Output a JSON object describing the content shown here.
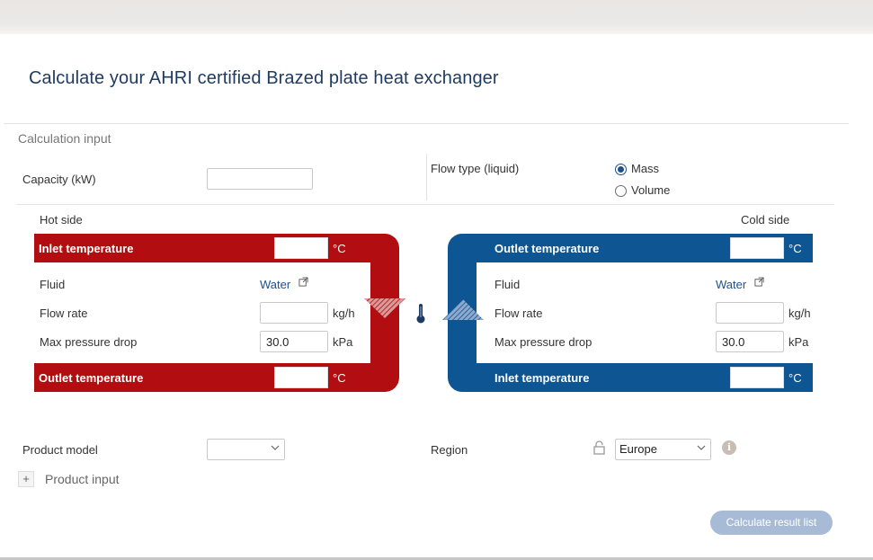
{
  "page": {
    "title": "Calculate your AHRI certified Brazed plate heat exchanger"
  },
  "calculation_input": {
    "section_title": "Calculation input",
    "capacity_label": "Capacity (kW)",
    "capacity_value": "",
    "flow_type_label": "Flow type (liquid)",
    "flow_type_options": [
      "Mass",
      "Volume"
    ],
    "flow_type_selected": "Mass"
  },
  "hot_side": {
    "title": "Hot side",
    "inlet_label": "Inlet temperature",
    "inlet_value": "",
    "inlet_unit": "°C",
    "fluid_label": "Fluid",
    "fluid_value": "Water",
    "flow_rate_label": "Flow rate",
    "flow_rate_value": "",
    "flow_rate_unit": "kg/h",
    "pressure_label": "Max pressure drop",
    "pressure_value": "30.0",
    "pressure_unit": "kPa",
    "outlet_label": "Outlet temperature",
    "outlet_value": "",
    "outlet_unit": "°C",
    "color": "#b20d10"
  },
  "cold_side": {
    "title": "Cold side",
    "outlet_label": "Outlet temperature",
    "outlet_value": "",
    "outlet_unit": "°C",
    "fluid_label": "Fluid",
    "fluid_value": "Water",
    "flow_rate_label": "Flow rate",
    "flow_rate_value": "",
    "flow_rate_unit": "kg/h",
    "pressure_label": "Max pressure drop",
    "pressure_value": "30.0",
    "pressure_unit": "kPa",
    "inlet_label": "Inlet temperature",
    "inlet_value": "",
    "inlet_unit": "°C",
    "color": "#0e5593"
  },
  "product": {
    "model_label": "Product model",
    "model_value": "",
    "region_label": "Region",
    "region_value": "Europe",
    "product_input_label": "Product input",
    "expand_symbol": "+"
  },
  "actions": {
    "calculate_label": "Calculate result list"
  },
  "icons": {
    "thermometer": "thermometer-icon",
    "external_link": "external-link-icon",
    "lock": "lock-icon",
    "info": "info-icon"
  }
}
